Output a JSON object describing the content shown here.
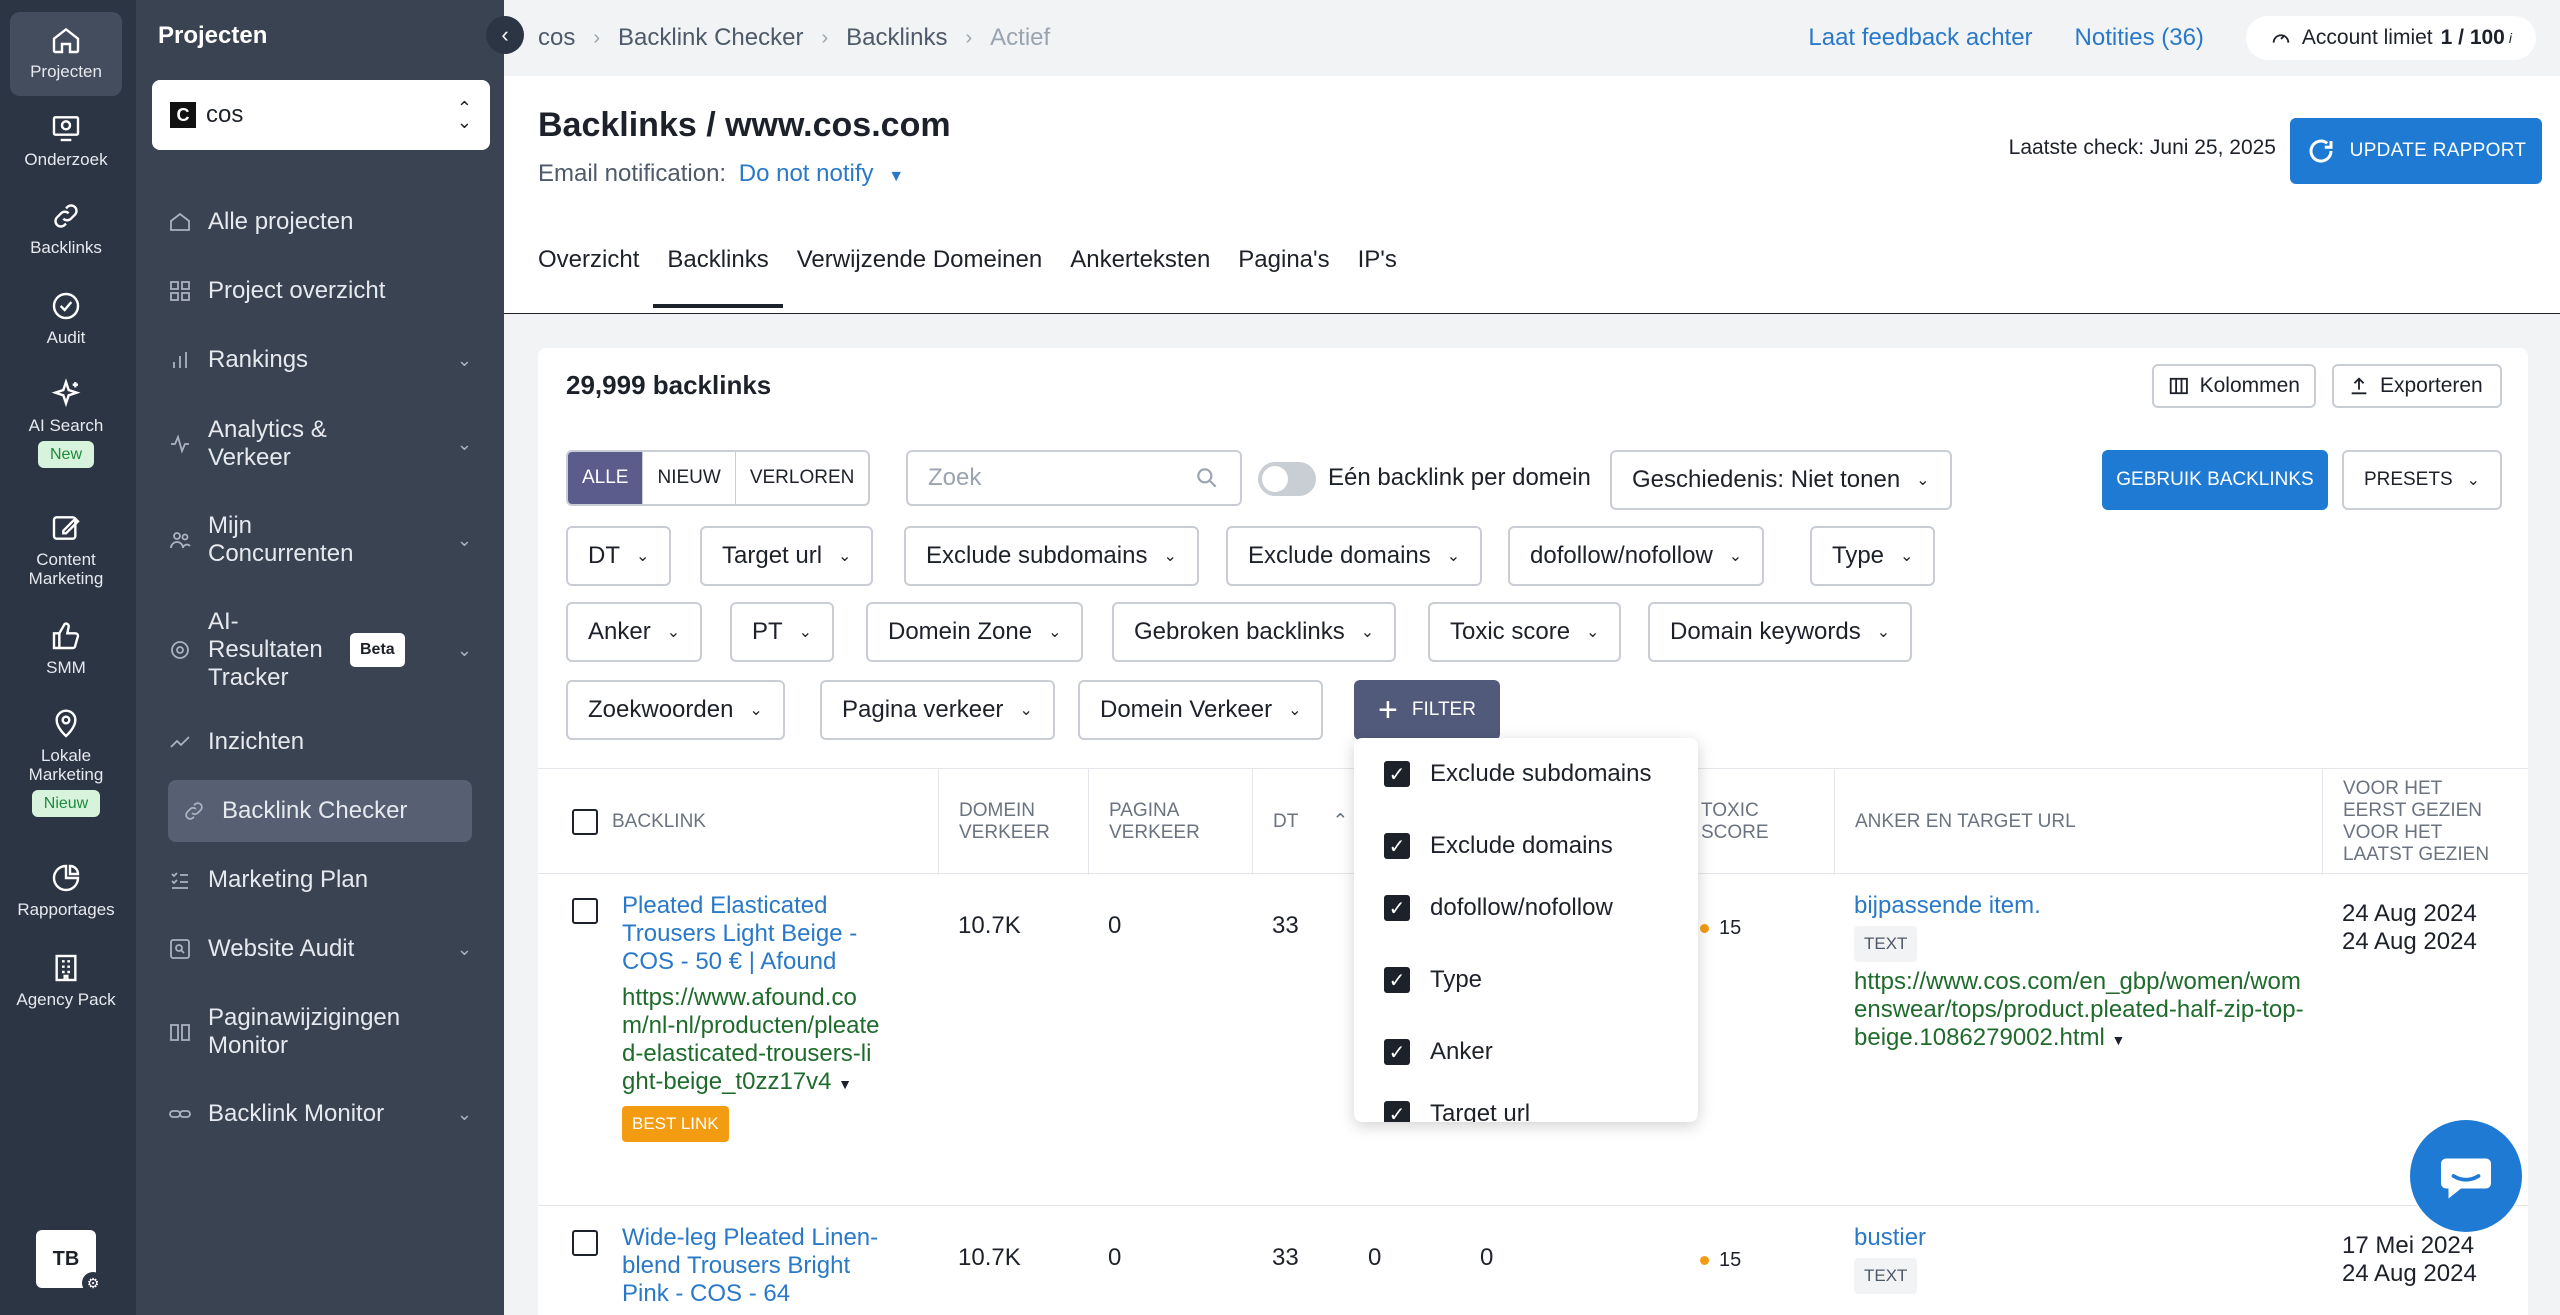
{
  "rail": {
    "items": [
      {
        "label": "Projecten",
        "icon": "home-icon"
      },
      {
        "label": "Onderzoek",
        "icon": "research-icon"
      },
      {
        "label": "Backlinks",
        "icon": "link-icon"
      },
      {
        "label": "Audit",
        "icon": "check-circle-icon"
      },
      {
        "label": "AI Search",
        "icon": "sparkle-icon",
        "badge": "New"
      },
      {
        "label": "Content Marketing",
        "icon": "edit-icon"
      },
      {
        "label": "SMM",
        "icon": "thumbs-up-icon"
      },
      {
        "label": "Lokale Marketing",
        "icon": "location-pin-icon",
        "badge": "Nieuw"
      },
      {
        "label": "Rapportages",
        "icon": "pie-chart-icon"
      },
      {
        "label": "Agency Pack",
        "icon": "building-icon"
      }
    ],
    "avatar": "TB"
  },
  "sidebar": {
    "title": "Projecten",
    "project": {
      "logo": "C",
      "name": "cos"
    },
    "items": [
      {
        "label": "Alle projecten"
      },
      {
        "label": "Project overzicht"
      },
      {
        "label": "Rankings"
      },
      {
        "label": "Analytics & Verkeer"
      },
      {
        "label": "Mijn Concurrenten"
      },
      {
        "label": "AI-Resultaten Tracker",
        "badge": "Beta"
      },
      {
        "label": "Inzichten"
      },
      {
        "label": "Backlink Checker"
      },
      {
        "label": "Marketing Plan"
      },
      {
        "label": "Website Audit"
      },
      {
        "label": "Paginawijzigingen Monitor"
      },
      {
        "label": "Backlink Monitor"
      }
    ]
  },
  "breadcrumb": [
    "cos",
    "Backlink Checker",
    "Backlinks",
    "Actief"
  ],
  "topbar": {
    "feedback": "Laat feedback achter",
    "notes": "Notities (36)",
    "account_label": "Account limiet",
    "account_value": "1 / 100",
    "info": "i"
  },
  "header": {
    "title": "Backlinks / www.cos.com",
    "email_label": "Email notification:",
    "email_value": "Do not notify",
    "last_check": "Laatste check: Juni 25, 2025",
    "update_button": "UPDATE RAPPORT"
  },
  "tabs": [
    "Overzicht",
    "Backlinks",
    "Verwijzende Domeinen",
    "Ankerteksten",
    "Pagina's",
    "IP's"
  ],
  "toolbar": {
    "count": "29,999 backlinks",
    "columns": "Kolommen",
    "export": "Exporteren",
    "segments": [
      "ALLE",
      "NIEUW",
      "VERLOREN"
    ],
    "search_placeholder": "Zoek",
    "toggle_label": "Eén backlink per domein",
    "history": "Geschiedenis: Niet tonen",
    "use_backlinks": "GEBRUIK BACKLINKS",
    "presets": "PRESETS",
    "filter_button": "FILTER"
  },
  "filters": {
    "row1": [
      "DT",
      "Target url",
      "Exclude subdomains",
      "Exclude domains",
      "dofollow/nofollow",
      "Type"
    ],
    "row2": [
      "Anker",
      "PT",
      "Domein Zone",
      "Gebroken backlinks",
      "Toxic score",
      "Domain keywords"
    ],
    "row3": [
      "Zoekwoorden",
      "Pagina verkeer",
      "Domein Verkeer"
    ]
  },
  "dropdown": [
    "Exclude subdomains",
    "Exclude domains",
    "dofollow/nofollow",
    "Type",
    "Anker",
    "Target url"
  ],
  "table": {
    "headers": {
      "backlink": "BACKLINK",
      "domain_traffic": "DOMEIN VERKEER",
      "page_traffic": "PAGINA VERKEER",
      "dt": "DT",
      "toxic": "TOXIC SCORE",
      "anchor": "ANKER EN TARGET URL",
      "seen": "VOOR HET EERST GEZIEN VOOR HET LAATST GEZIEN"
    },
    "rows": [
      {
        "title": "Pleated Elasticated Trousers Light Beige - COS - 50 € | Afound",
        "url": "https://www.afound.com/nl-nl/producten/pleated-elasticated-trousers-light-beige_t0zz17v4",
        "badge": "BEST LINK",
        "domain_traffic": "10.7K",
        "page_traffic": "0",
        "dt": "33",
        "toxic": "15",
        "anchor": "bijpassende item.",
        "anchor_type": "TEXT",
        "target": "https://www.cos.com/en_gbp/women/womenswear/tops/product.pleated-half-zip-top-beige.1086279002.html",
        "first_seen": "24 Aug 2024",
        "last_seen": "24 Aug 2024"
      },
      {
        "title": "Wide-leg Pleated Linen-blend Trousers Bright Pink - COS - 64",
        "domain_traffic": "10.7K",
        "page_traffic": "0",
        "dt": "33",
        "extra1": "0",
        "extra2": "0",
        "toxic": "15",
        "anchor": "bustier",
        "anchor_type": "TEXT",
        "first_seen": "17 Mei 2024",
        "last_seen": "24 Aug 2024"
      }
    ]
  },
  "colors": {
    "accent": "#1f7ad3",
    "rail": "#2c3544",
    "sidebar": "#3a4352",
    "segment_on": "#5b5c8c",
    "url_green": "#1f6b2c",
    "best": "#f39c12"
  }
}
